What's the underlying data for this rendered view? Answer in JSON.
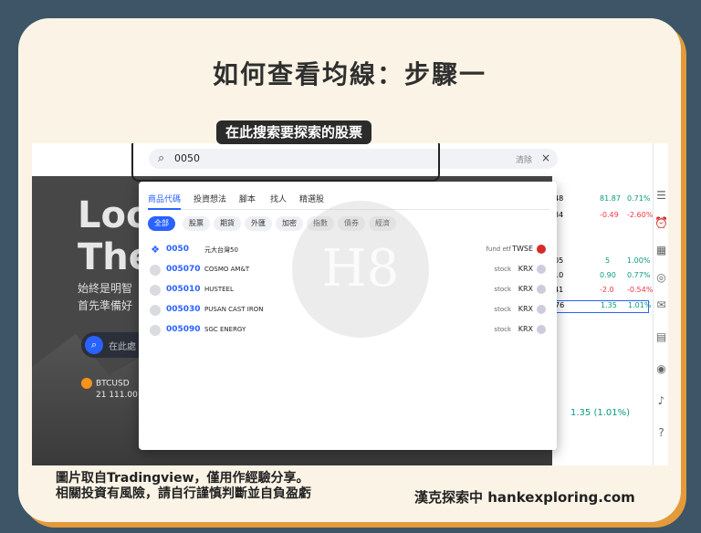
{
  "title": "如何查看均線：步驟一",
  "callout": "在此搜索要探索的股票",
  "search": {
    "value": "0050",
    "clear_label": "清除",
    "close_label": "×"
  },
  "hero": {
    "big_line1": "Loo",
    "big_line2": "The",
    "cn_line1": "始終是明智",
    "cn_line2": "首先準備好",
    "search_placeholder": "在此處",
    "btc_symbol": "BTCUSD",
    "btc_value": "21 111.00"
  },
  "dropdown": {
    "tabs": [
      "商品代碼",
      "投資想法",
      "腳本",
      "找人",
      "精選股"
    ],
    "chips": [
      "全部",
      "股票",
      "期貨",
      "外匯",
      "加密",
      "指數",
      "債券",
      "經濟"
    ],
    "results": [
      {
        "code": "0050",
        "name": "元大台灣50",
        "type": "fund etf",
        "exchange": "TWSE"
      },
      {
        "code": "005070",
        "name": "COSMO AM&T",
        "type": "stock",
        "exchange": "KRX"
      },
      {
        "code": "005010",
        "name": "HUSTEEL",
        "type": "stock",
        "exchange": "KRX"
      },
      {
        "code": "005030",
        "name": "PUSAN CAST IRON",
        "type": "stock",
        "exchange": "KRX"
      },
      {
        "code": "005090",
        "name": "SGC ENERGY",
        "type": "stock",
        "exchange": "KRX"
      }
    ]
  },
  "rightpanel": {
    "rows": [
      {
        "a": "48",
        "b": "81.87",
        "c": "0.71%"
      },
      {
        "a": "34",
        "b": "-0.49",
        "c": "-2.60%"
      },
      {
        "a": "05",
        "b": "5",
        "c": "1.00%"
      },
      {
        "a": "10",
        "b": "0.90",
        "c": "0.77%"
      },
      {
        "a": "41",
        "b": "-2.0",
        "c": "-0.54%"
      },
      {
        "a": "76",
        "b": "1.35",
        "c": "1.01%"
      }
    ],
    "note": "1.35 (1.01%)"
  },
  "watermark": "H8",
  "footer": {
    "line1": "圖片取自Tradingview，僅用作經驗分享。",
    "line2": "相關投資有風險，請自行謹慎判斷並自負盈虧",
    "brand": "漢克探索中 hankexploring.com"
  },
  "colors": {
    "accent": "#2962ff",
    "frame": "#3d5566",
    "card": "#fbf4e6",
    "shadow": "#e39a3b"
  }
}
